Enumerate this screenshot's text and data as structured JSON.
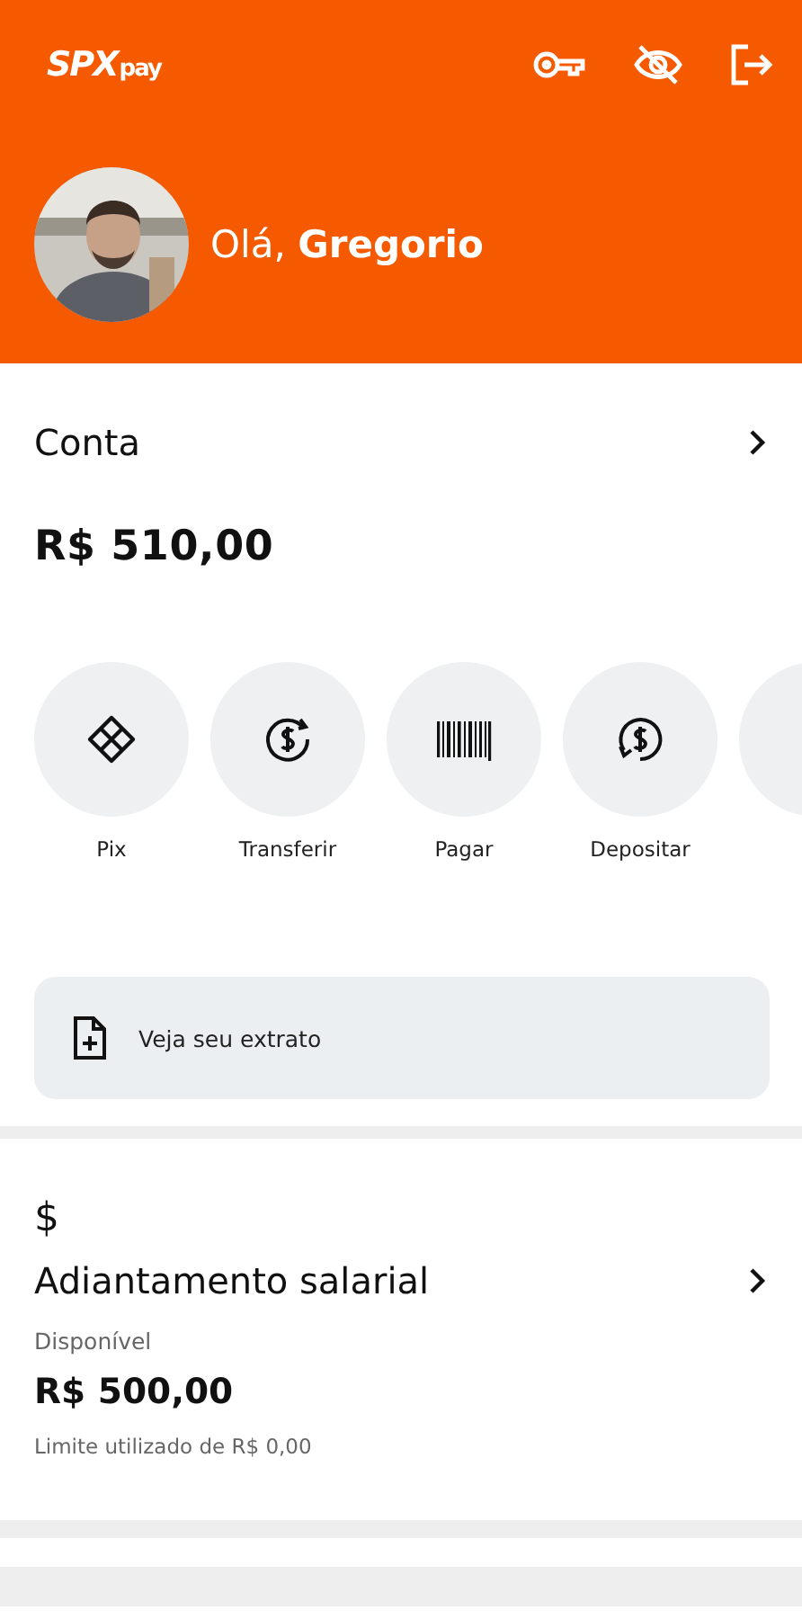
{
  "header": {
    "logo": {
      "main": "SPX",
      "sub": "pay"
    },
    "greeting": "Olá,",
    "user_name": "Gregorio"
  },
  "account": {
    "title": "Conta",
    "balance": "R$ 510,00"
  },
  "actions": [
    {
      "label": "Pix"
    },
    {
      "label": "Transferir"
    },
    {
      "label": "Pagar"
    },
    {
      "label": "Depositar"
    }
  ],
  "statement": {
    "label": "Veja seu extrato"
  },
  "salary_advance": {
    "symbol": "$",
    "title": "Adiantamento salarial",
    "available_label": "Disponível",
    "amount": "R$ 500,00",
    "limit": "Limite utilizado de R$ 0,00"
  }
}
